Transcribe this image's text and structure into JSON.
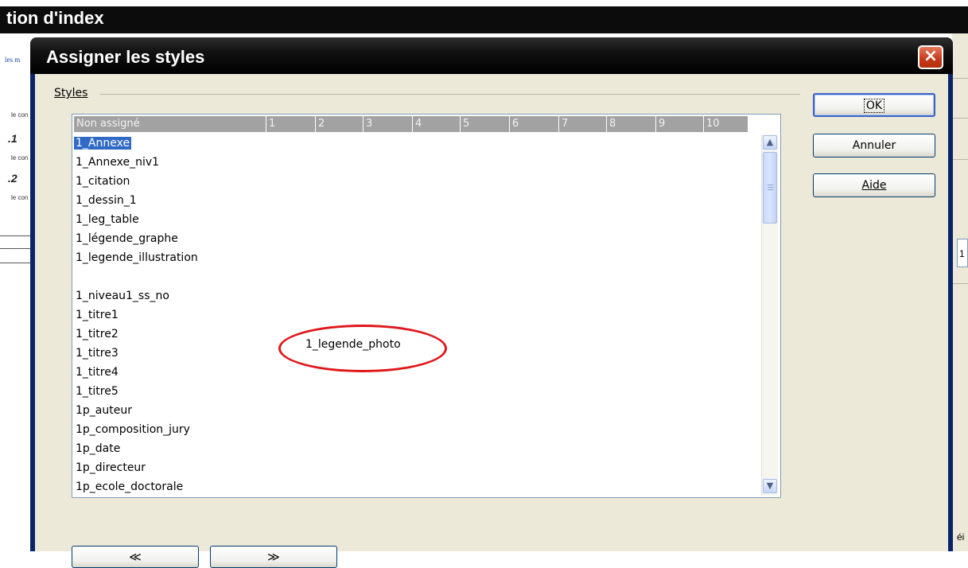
{
  "parent_window": {
    "title": "tion d'index",
    "left_tab": "les m",
    "left_texts": [
      "le con",
      "le con",
      "le con"
    ],
    "left_nums": [
      ".1",
      ".2"
    ],
    "right_value": "1",
    "right_cut_text": "éi"
  },
  "dialog": {
    "title": "Assigner les styles",
    "close_icon": "×"
  },
  "styles_group": {
    "label": "Styles"
  },
  "table": {
    "headers": [
      "Non assigné",
      "1",
      "2",
      "3",
      "4",
      "5",
      "6",
      "7",
      "8",
      "9",
      "10"
    ],
    "rows": [
      "1_Annexe",
      "1_Annexe_niv1",
      "1_citation",
      "1_dessin_1",
      "1_leg_table",
      "1_légende_graphe",
      "1_legende_illustration",
      "",
      "1_niveau1_ss_no",
      "1_titre1",
      "1_titre2",
      "1_titre3",
      "1_titre4",
      "1_titre5",
      "1p_auteur",
      "1p_composition_jury",
      "1p_date",
      "1p_directeur",
      "1p_ecole_doctorale"
    ],
    "selected_row": "1_Annexe",
    "highlighted_item": "1_legende_photo"
  },
  "buttons": {
    "ok": "OK",
    "cancel": "Annuler",
    "help": "Aide",
    "left_nav": "≪",
    "right_nav": "≫"
  },
  "colors": {
    "selection": "#316ac5",
    "annotation": "#e0161a",
    "header_bg": "#a2a2a2",
    "dialog_bg": "#ece9d8"
  }
}
